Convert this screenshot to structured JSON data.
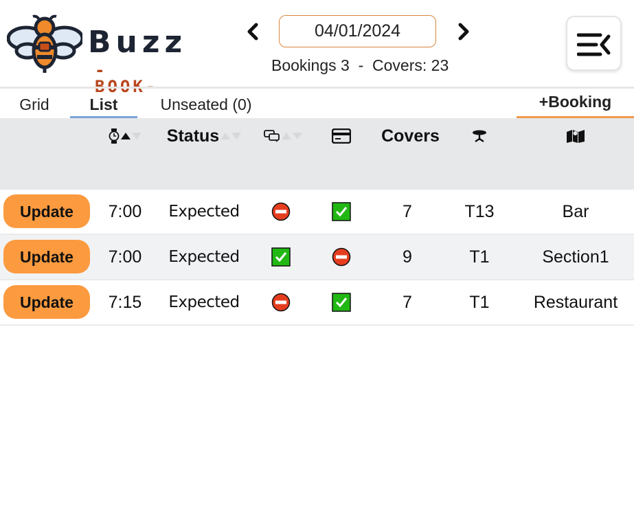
{
  "app": {
    "logo_word": "Buzz",
    "logo_sub": "-BOOK-"
  },
  "header": {
    "date": "04/01/2024",
    "summary": "Bookings 3  -  Covers: 23",
    "prev_icon": "chevron-left-icon",
    "next_icon": "chevron-right-icon",
    "menu_icon": "menu-collapse-icon"
  },
  "tabs": {
    "grid": "Grid",
    "list": "List",
    "unseated": "Unseated (0)",
    "add_booking": "+Booking",
    "active": "List"
  },
  "table": {
    "headers": {
      "time_icon": "watch-icon",
      "status": "Status",
      "notes_icon": "chat-icon",
      "payment_icon": "credit-card-icon",
      "covers": "Covers",
      "table_icon": "table-icon",
      "area_icon": "map-icon"
    },
    "sort": {
      "column": "time",
      "direction": "ascending"
    },
    "rows": [
      {
        "action": "Update",
        "time": "7:00",
        "status": "Expected",
        "notes": "no",
        "paid": "yes",
        "covers": "7",
        "table": "T13",
        "area": "Bar"
      },
      {
        "action": "Update",
        "time": "7:00",
        "status": "Expected",
        "notes": "yes",
        "paid": "no",
        "covers": "9",
        "table": "T1",
        "area": "Section1"
      },
      {
        "action": "Update",
        "time": "7:15",
        "status": "Expected",
        "notes": "no",
        "paid": "yes",
        "covers": "7",
        "table": "T1",
        "area": "Restaurant"
      }
    ]
  },
  "colors": {
    "accent": "#fb9a3e",
    "active_tab": "#7aa5d6",
    "check": "#22b814",
    "stop": "#e53e1f",
    "header_bg": "#e6e8ea"
  }
}
